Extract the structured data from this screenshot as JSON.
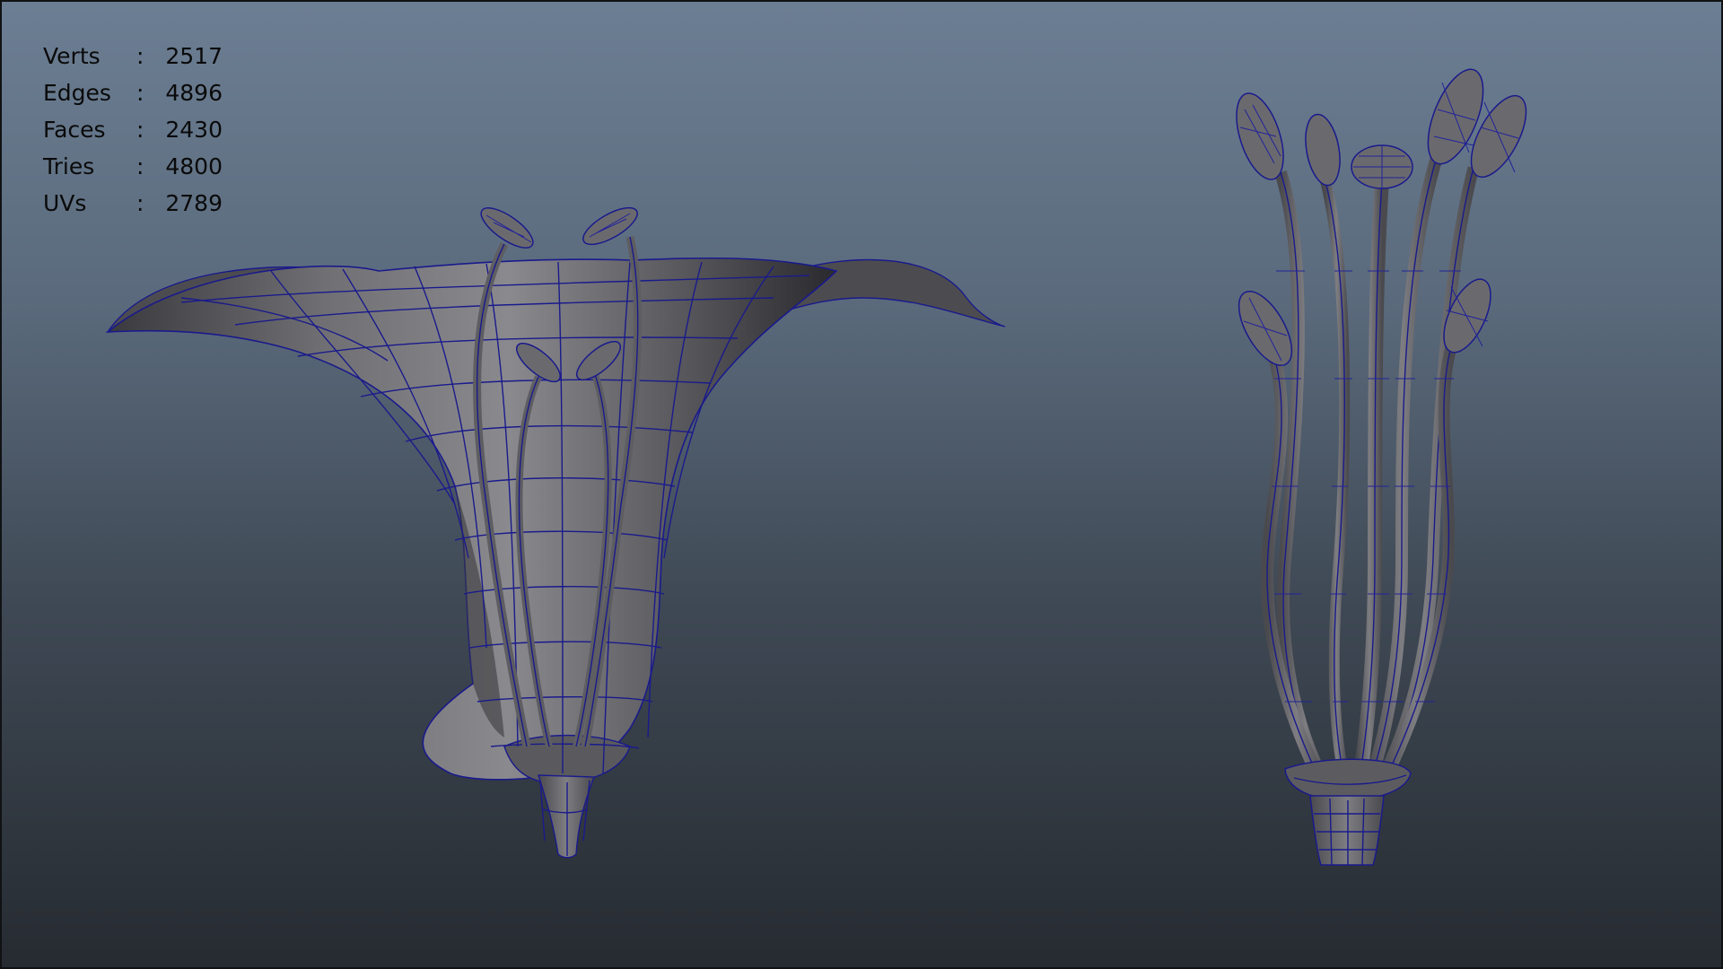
{
  "stats": [
    {
      "label": "Verts",
      "sep": ":",
      "value": "2517"
    },
    {
      "label": "Edges",
      "sep": ":",
      "value": "4896"
    },
    {
      "label": "Faces",
      "sep": ":",
      "value": "2430"
    },
    {
      "label": "Tries",
      "sep": ":",
      "value": "4800"
    },
    {
      "label": "UVs",
      "sep": ":",
      "value": "2789"
    }
  ],
  "colors": {
    "background_top": "#6c7e93",
    "background_bottom": "#262b31",
    "mesh_fill": "#6e6e72",
    "wireframe": "#1a1a8c"
  }
}
